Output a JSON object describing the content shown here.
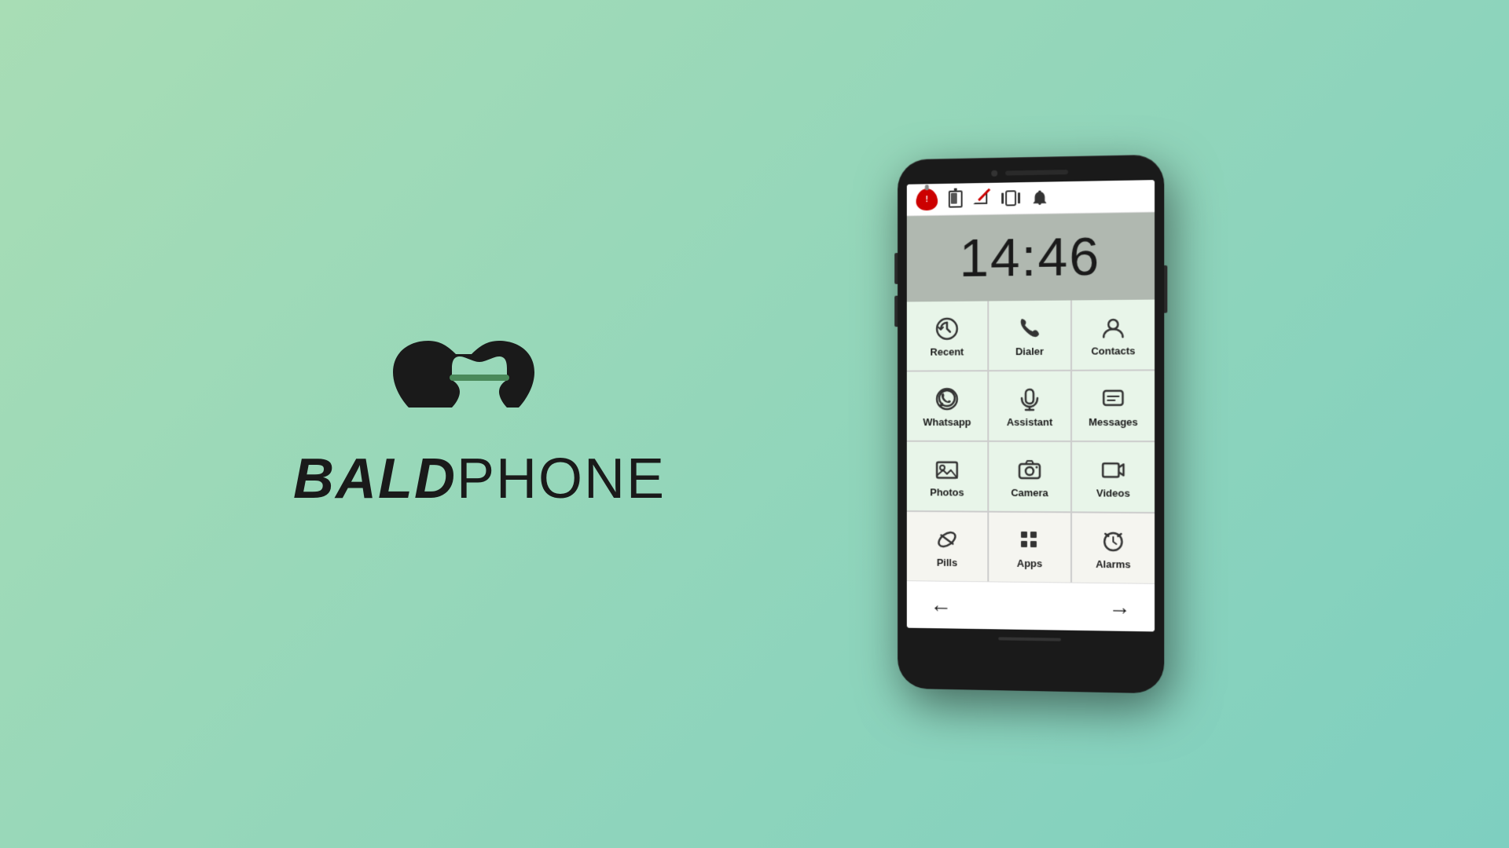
{
  "brand": {
    "bald": "BALD",
    "phone": "PHONE"
  },
  "clock": {
    "time": "14:46"
  },
  "status_icons": {
    "alert": "🚨",
    "battery": "🔋",
    "signal": "📵",
    "vibrate": "📳",
    "bell": "🔔"
  },
  "app_buttons": [
    {
      "id": "recent",
      "label": "Recent",
      "icon": "🕐",
      "style": "green"
    },
    {
      "id": "dialer",
      "label": "Dialer",
      "icon": "📞",
      "style": "green"
    },
    {
      "id": "contacts",
      "label": "Contacts",
      "icon": "👤",
      "style": "green"
    },
    {
      "id": "whatsapp",
      "label": "Whatsapp",
      "icon": "💬",
      "style": "green"
    },
    {
      "id": "assistant",
      "label": "Assistant",
      "icon": "🎤",
      "style": "green"
    },
    {
      "id": "messages",
      "label": "Messages",
      "icon": "💬",
      "style": "green"
    },
    {
      "id": "photos",
      "label": "Photos",
      "icon": "🖼",
      "style": "green"
    },
    {
      "id": "camera",
      "label": "Camera",
      "icon": "📷",
      "style": "green"
    },
    {
      "id": "videos",
      "label": "Videos",
      "icon": "🎬",
      "style": "green"
    },
    {
      "id": "pills",
      "label": "Pills",
      "icon": "💊",
      "style": "light"
    },
    {
      "id": "apps",
      "label": "Apps",
      "icon": "⋮⋮⋮",
      "style": "light"
    },
    {
      "id": "alarms",
      "label": "Alarms",
      "icon": "⏰",
      "style": "light"
    }
  ],
  "navigation": {
    "back_arrow": "←",
    "forward_arrow": "→"
  },
  "page_dots": [
    {
      "active": false
    },
    {
      "active": false
    },
    {
      "active": true
    },
    {
      "active": false
    }
  ]
}
